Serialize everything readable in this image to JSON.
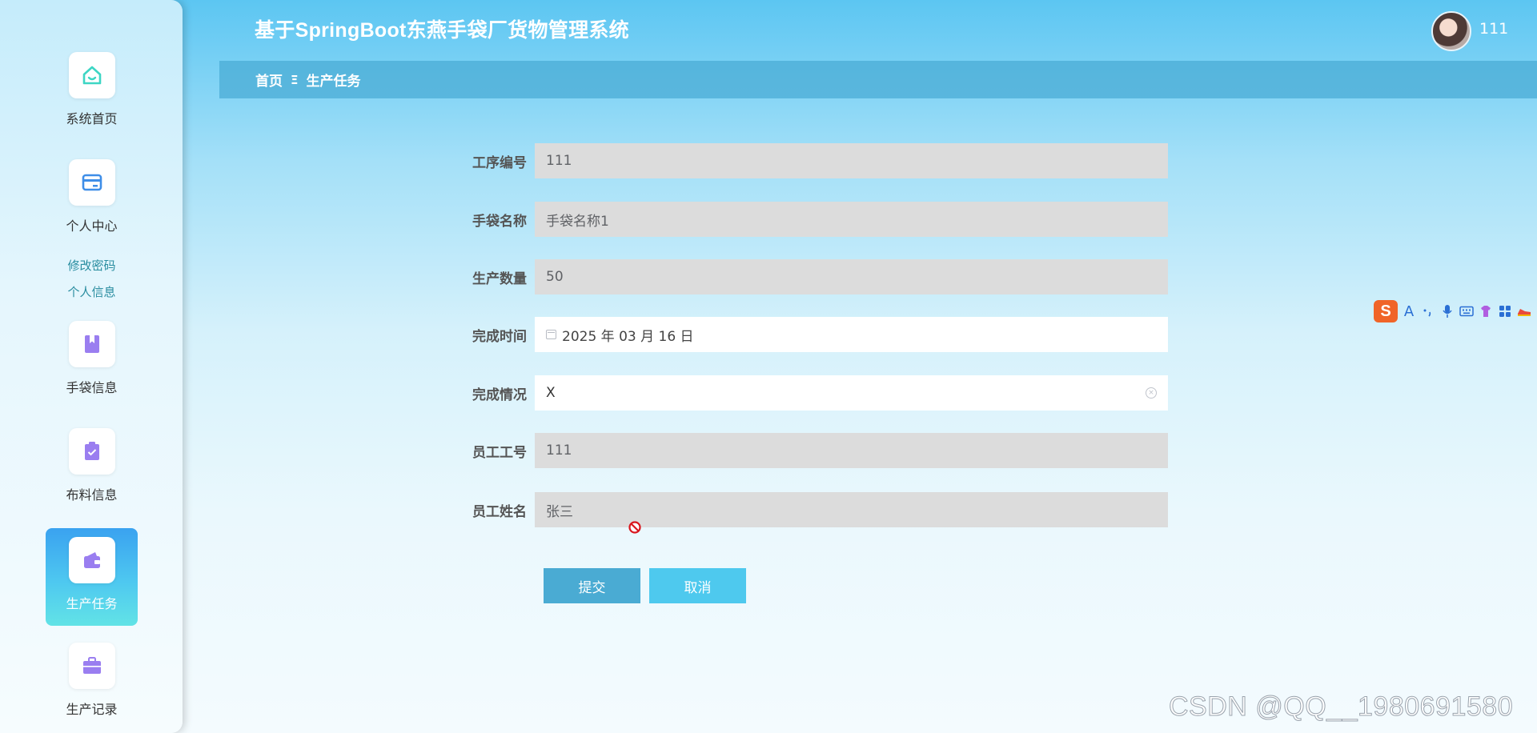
{
  "header": {
    "app_title": "基于SpringBoot东燕手袋厂货物管理系统",
    "username": "111"
  },
  "breadcrumb": {
    "home": "首页",
    "separator": "Ξ",
    "current": "生产任务"
  },
  "sidebar": {
    "items": [
      {
        "label": "系统首页",
        "icon": "home-icon"
      },
      {
        "label": "个人中心",
        "icon": "card-icon"
      },
      {
        "label": "手袋信息",
        "icon": "book-icon"
      },
      {
        "label": "布料信息",
        "icon": "clipboard-icon"
      },
      {
        "label": "生产任务",
        "icon": "wallet-icon",
        "active": true
      },
      {
        "label": "生产记录",
        "icon": "briefcase-icon"
      }
    ],
    "sub_links": [
      "修改密码",
      "个人信息"
    ]
  },
  "form": {
    "fields": [
      {
        "label": "工序编号",
        "value": "111"
      },
      {
        "label": "手袋名称",
        "value": "手袋名称1"
      },
      {
        "label": "生产数量",
        "value": "50"
      },
      {
        "label": "完成时间",
        "value": "2025 年 03 月 16 日"
      },
      {
        "label": "完成情况",
        "value": "X"
      },
      {
        "label": "员工工号",
        "value": "111"
      },
      {
        "label": "员工姓名",
        "value": "张三"
      }
    ],
    "submit_label": "提交",
    "cancel_label": "取消"
  },
  "ime": {
    "logo": "S",
    "chinese_mode": "A"
  },
  "watermark": "CSDN @QQ__1980691580",
  "colors": {
    "accent": "#4aabd3",
    "cancel": "#4ec9ee",
    "readonly_field": "#dcdcdc"
  }
}
